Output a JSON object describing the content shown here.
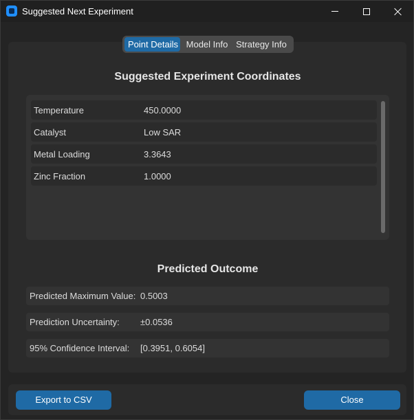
{
  "window": {
    "title": "Suggested Next Experiment",
    "accent_color": "#1f6aa5"
  },
  "tabs": [
    {
      "label": "Point Details",
      "active": true
    },
    {
      "label": "Model Info",
      "active": false
    },
    {
      "label": "Strategy Info",
      "active": false
    }
  ],
  "coordinates": {
    "title": "Suggested Experiment Coordinates",
    "rows": [
      {
        "label": "Temperature",
        "value": "450.0000"
      },
      {
        "label": "Catalyst",
        "value": "Low SAR"
      },
      {
        "label": "Metal Loading",
        "value": "3.3643"
      },
      {
        "label": "Zinc Fraction",
        "value": "1.0000"
      }
    ]
  },
  "outcome": {
    "title": "Predicted Outcome",
    "rows": [
      {
        "label": "Predicted Maximum Value:",
        "value": "0.5003"
      },
      {
        "label": "Prediction Uncertainty:",
        "value": "±0.0536"
      },
      {
        "label": "95% Confidence Interval:",
        "value": "[0.3951, 0.6054]"
      }
    ]
  },
  "actions": {
    "export_label": "Export to CSV",
    "close_label": "Close"
  },
  "icons": {
    "app": "app-icon",
    "minimize": "minimize-icon",
    "maximize": "maximize-icon",
    "close": "close-icon"
  }
}
